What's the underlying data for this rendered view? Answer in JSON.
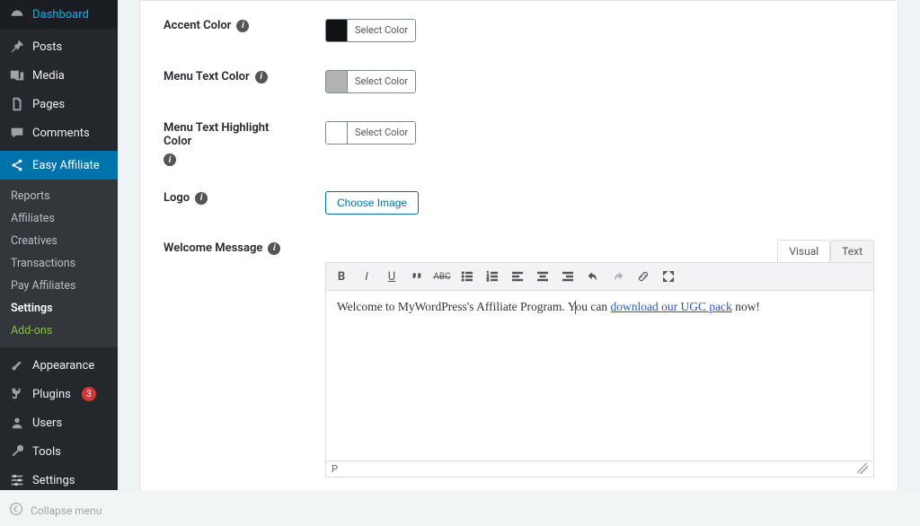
{
  "sidebar": {
    "items": [
      {
        "label": "Dashboard"
      },
      {
        "label": "Posts"
      },
      {
        "label": "Media"
      },
      {
        "label": "Pages"
      },
      {
        "label": "Comments"
      },
      {
        "label": "Easy Affiliate"
      },
      {
        "label": "Appearance"
      },
      {
        "label": "Plugins",
        "badge": "3"
      },
      {
        "label": "Users"
      },
      {
        "label": "Tools"
      },
      {
        "label": "Settings"
      }
    ],
    "submenu": [
      {
        "label": "Reports"
      },
      {
        "label": "Affiliates"
      },
      {
        "label": "Creatives"
      },
      {
        "label": "Transactions"
      },
      {
        "label": "Pay Affiliates"
      },
      {
        "label": "Settings"
      },
      {
        "label": "Add-ons"
      }
    ],
    "collapse": "Collapse menu"
  },
  "fields": {
    "accent": {
      "label": "Accent Color",
      "btn": "Select Color",
      "swatch": "#111111"
    },
    "menutext": {
      "label": "Menu Text Color",
      "btn": "Select Color",
      "swatch": "#b3b3b3"
    },
    "highlight": {
      "label": "Menu Text Highlight Color",
      "btn": "Select Color",
      "swatch": "#ffffff"
    },
    "logo": {
      "label": "Logo",
      "btn": "Choose Image"
    },
    "welcome": {
      "label": "Welcome Message"
    }
  },
  "editor": {
    "tabs": {
      "visual": "Visual",
      "text": "Text"
    },
    "content_prefix": "Welcome to MyWordPress's Affiliate Program. Y",
    "content_mid": "ou can ",
    "content_link": "download our UGC pack",
    "content_suffix": " now!",
    "path": "P"
  }
}
